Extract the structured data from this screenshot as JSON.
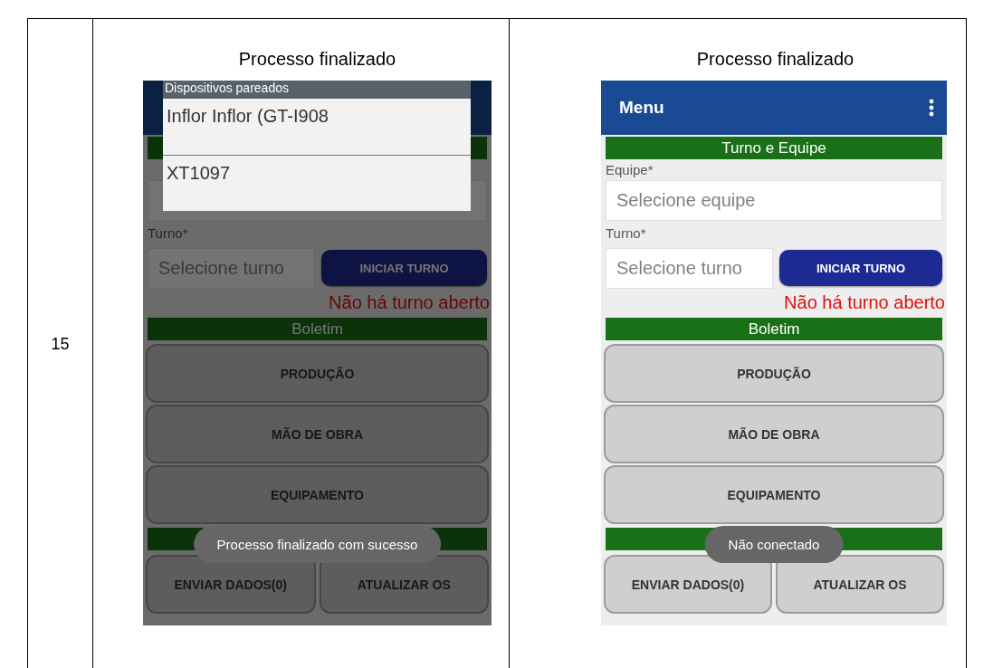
{
  "table": {
    "row_number": "15",
    "cells": [
      {
        "caption": "Processo finalizado",
        "phone": {
          "dimmed": true,
          "dialog": {
            "title": "Dispositivos pareados",
            "items": [
              "Inflor Inflor (GT-I908",
              "XT1097"
            ]
          },
          "shift_label": "Turno*",
          "shift_placeholder": "Selecione turno",
          "start_button": "INICIAR TURNO",
          "status": "Não há turno aberto",
          "bulletin_header": "Boletim",
          "actions": [
            "PRODUÇÃO",
            "MÃO DE OBRA",
            "EQUIPAMENTO"
          ],
          "footer_buttons": [
            "ENVIAR DADOS(0)",
            "ATUALIZAR OS"
          ],
          "toast": "Processo finalizado com sucesso"
        }
      },
      {
        "caption": "Processo finalizado",
        "phone": {
          "dimmed": false,
          "app_bar": {
            "title": "Menu",
            "menu_icon": true
          },
          "team_header": "Turno e Equipe",
          "team_label": "Equipe*",
          "team_placeholder": "Selecione equipe",
          "shift_label": "Turno*",
          "shift_placeholder": "Selecione turno",
          "start_button": "INICIAR TURNO",
          "status": "Não há turno aberto",
          "bulletin_header": "Boletim",
          "actions": [
            "PRODUÇÃO",
            "MÃO DE OBRA",
            "EQUIPAMENTO"
          ],
          "footer_buttons": [
            "ENVIAR DADOS(0)",
            "ATUALIZAR OS"
          ],
          "toast": "Não conectado"
        }
      }
    ]
  }
}
